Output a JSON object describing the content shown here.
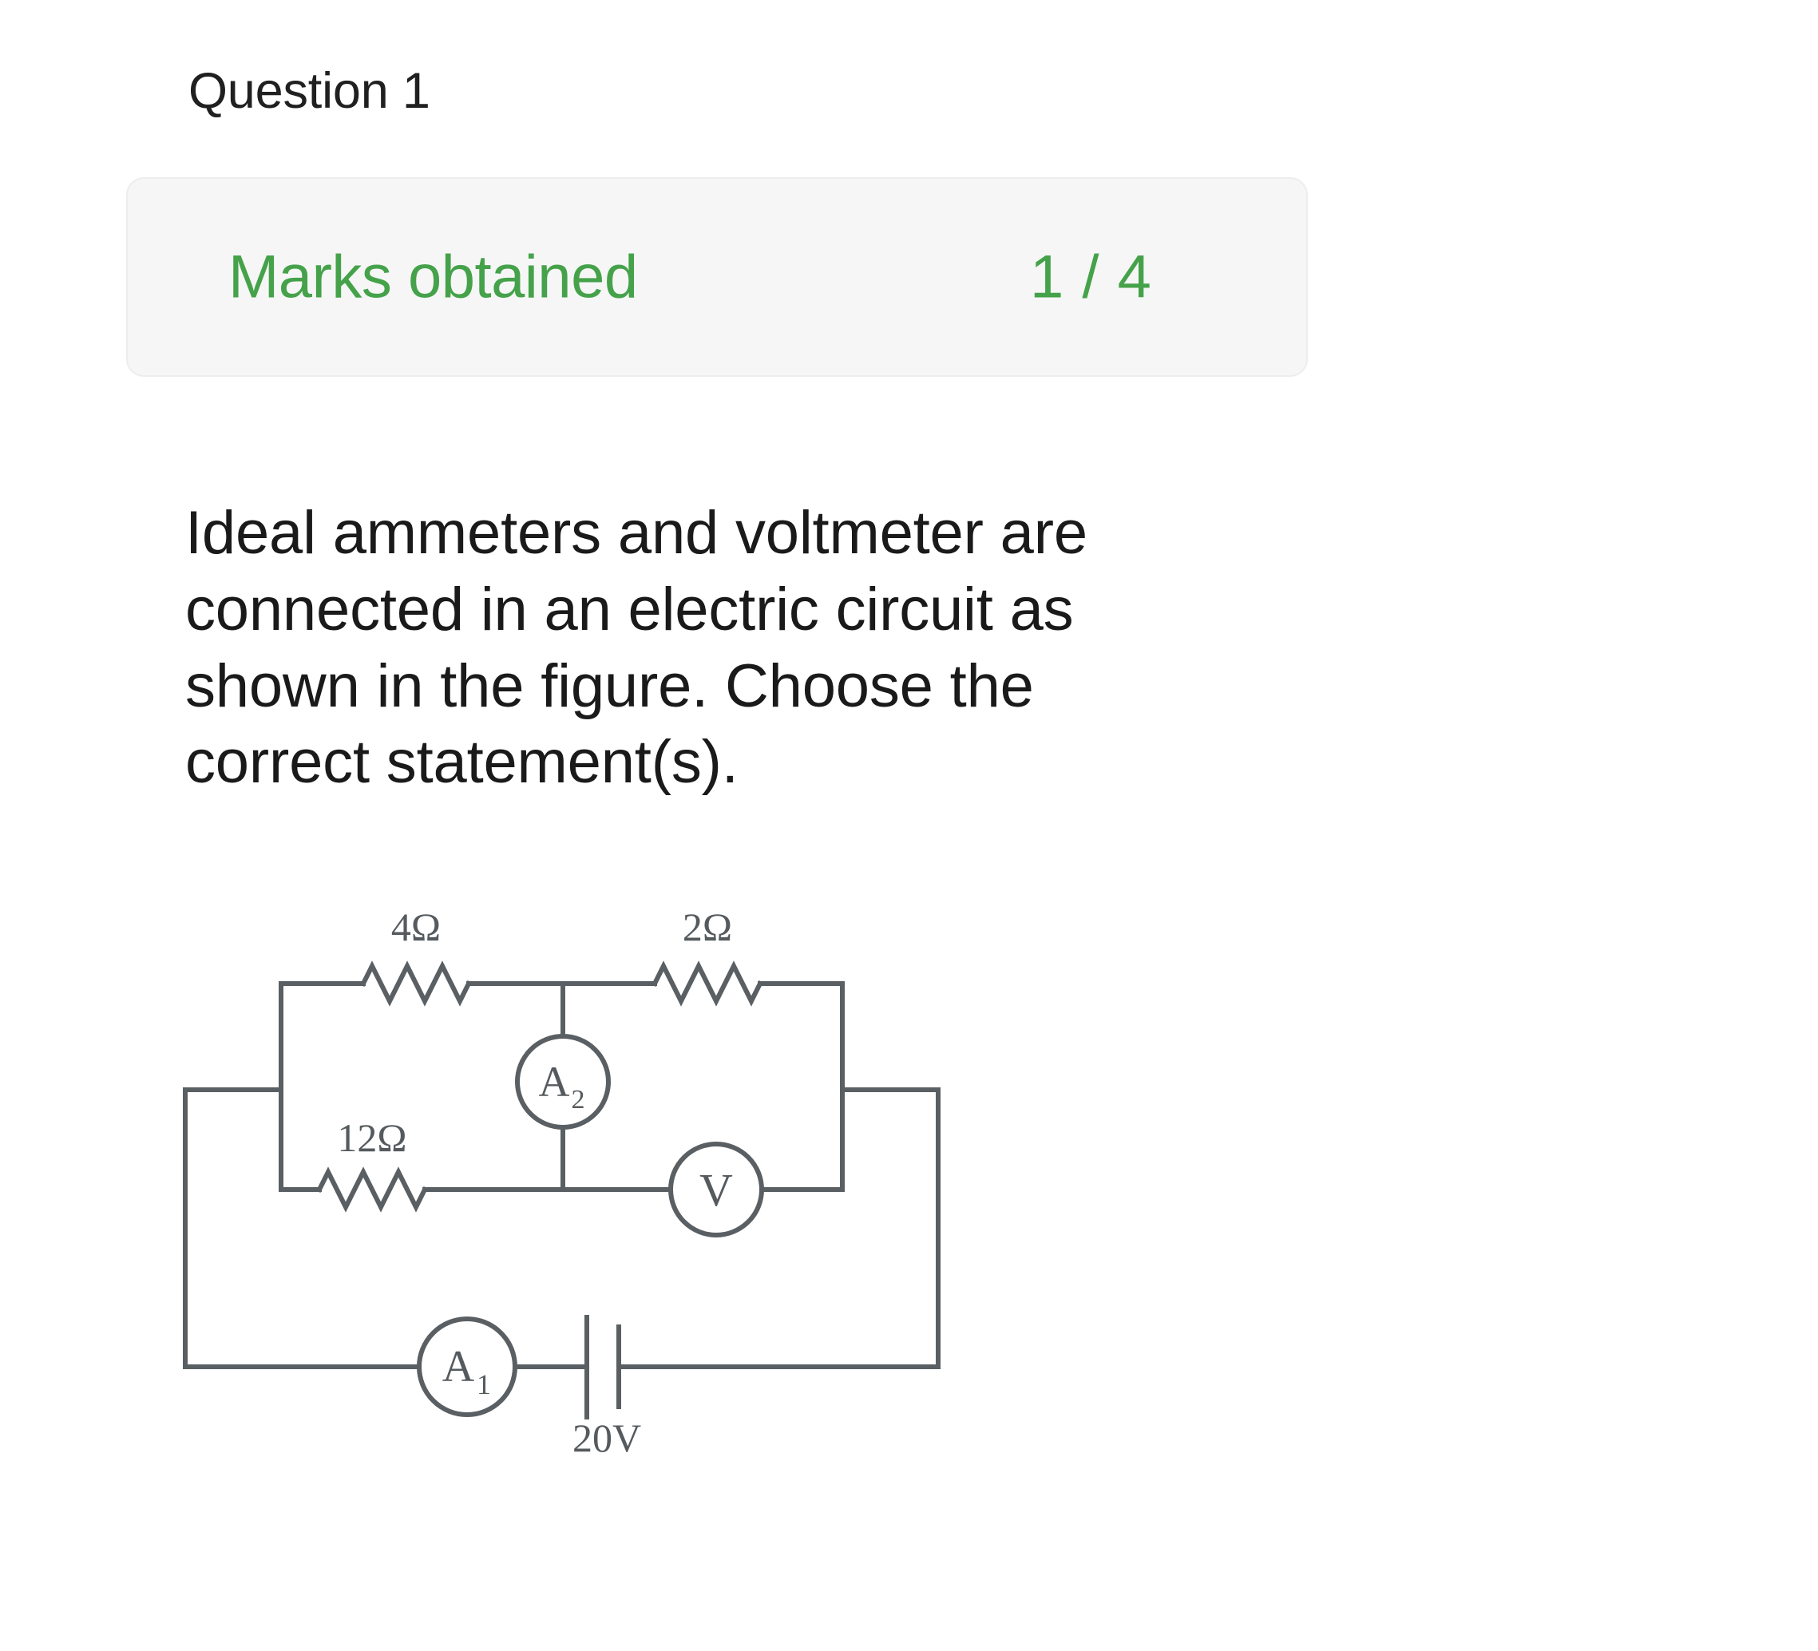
{
  "heading": {
    "question_label": "Question 1"
  },
  "marks_card": {
    "label": "Marks obtained",
    "score": "1 / 4",
    "obtained": 1,
    "total": 4,
    "accent_color": "#45a24a",
    "background_color": "#f6f6f6",
    "border_color": "#ededed"
  },
  "question": {
    "line1": "Ideal ammeters and voltmeter are",
    "line2": "connected in an electric circuit as",
    "line3": "shown in the figure. Choose the",
    "line4": "correct statement(s).",
    "full_text": "Ideal ammeters and voltmeter are connected in an electric circuit as shown in the figure. Choose the correct statement(s)."
  },
  "circuit": {
    "labels": {
      "r_top_left": "4Ω",
      "r_top_right": "2Ω",
      "r_middle": "12Ω",
      "source": "20V",
      "ammeter_1": "A",
      "ammeter_1_sub": "1",
      "ammeter_2": "A",
      "ammeter_2_sub": "2",
      "voltmeter": "V"
    },
    "components": [
      {
        "name": "resistor-4-ohm",
        "value": "4Ω"
      },
      {
        "name": "resistor-2-ohm",
        "value": "2Ω"
      },
      {
        "name": "resistor-12-ohm",
        "value": "12Ω"
      },
      {
        "name": "ammeter-a1",
        "value": "A1"
      },
      {
        "name": "ammeter-a2",
        "value": "A2"
      },
      {
        "name": "voltmeter-v",
        "value": "V"
      },
      {
        "name": "battery-20v",
        "value": "20V"
      }
    ],
    "line_color": "#5a5f63"
  }
}
